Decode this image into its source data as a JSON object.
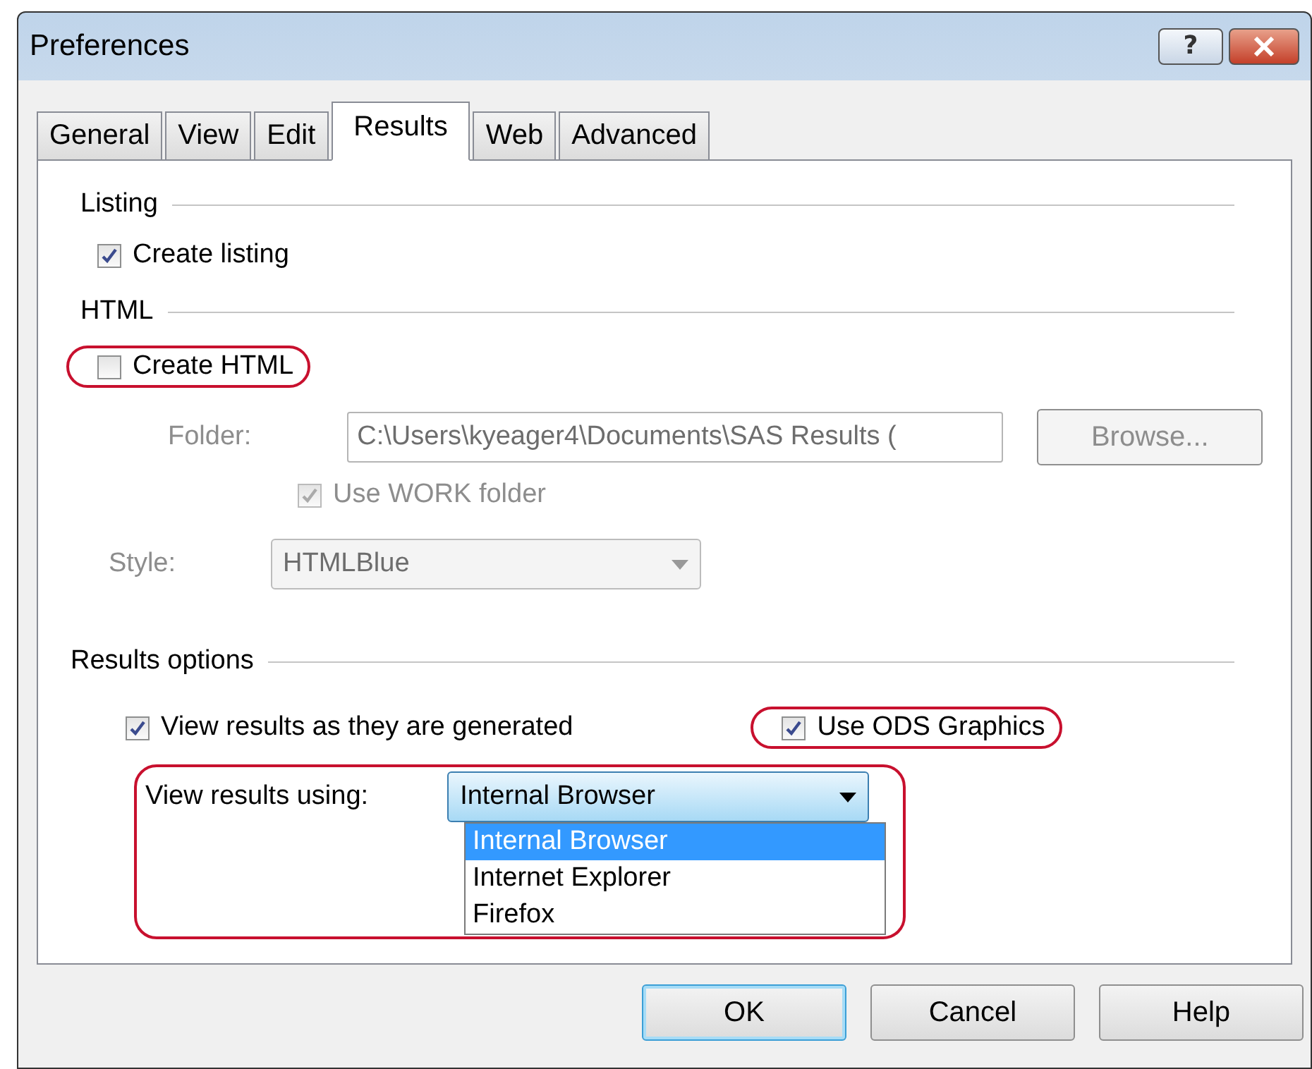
{
  "window": {
    "title": "Preferences",
    "help_label": "?"
  },
  "tabs": [
    {
      "label": "General",
      "selected": false
    },
    {
      "label": "View",
      "selected": false
    },
    {
      "label": "Edit",
      "selected": false
    },
    {
      "label": "Results",
      "selected": true
    },
    {
      "label": "Web",
      "selected": false
    },
    {
      "label": "Advanced",
      "selected": false
    }
  ],
  "listing": {
    "heading": "Listing",
    "create_listing": {
      "label": "Create listing",
      "checked": true,
      "disabled": false,
      "highlighted": false
    }
  },
  "html": {
    "heading": "HTML",
    "create_html": {
      "label": "Create HTML",
      "checked": false,
      "disabled": false,
      "highlighted": true
    },
    "folder": {
      "label": "Folder:",
      "value": "C:\\Users\\kyeager4\\Documents\\SAS Results (",
      "disabled": true
    },
    "browse_button": {
      "label": "Browse...",
      "disabled": true
    },
    "use_work_folder": {
      "label": "Use WORK folder",
      "checked": true,
      "disabled": true,
      "highlighted": false
    },
    "style": {
      "label": "Style:",
      "value": "HTMLBlue",
      "disabled": true
    }
  },
  "results_options": {
    "heading": "Results options",
    "view_as_generated": {
      "label": "View results as they are generated",
      "checked": true,
      "disabled": false,
      "highlighted": false
    },
    "use_ods_graphics": {
      "label": "Use ODS Graphics",
      "checked": true,
      "disabled": false,
      "highlighted": true
    },
    "view_using": {
      "label": "View results using:",
      "value": "Internal Browser",
      "highlighted": true,
      "expanded": true,
      "options": [
        {
          "label": "Internal Browser",
          "selected": true
        },
        {
          "label": "Internet Explorer",
          "selected": false
        },
        {
          "label": "Firefox",
          "selected": false
        }
      ]
    }
  },
  "buttons": [
    {
      "label": "OK",
      "default": true
    },
    {
      "label": "Cancel",
      "default": false
    },
    {
      "label": "Help",
      "default": false
    }
  ]
}
